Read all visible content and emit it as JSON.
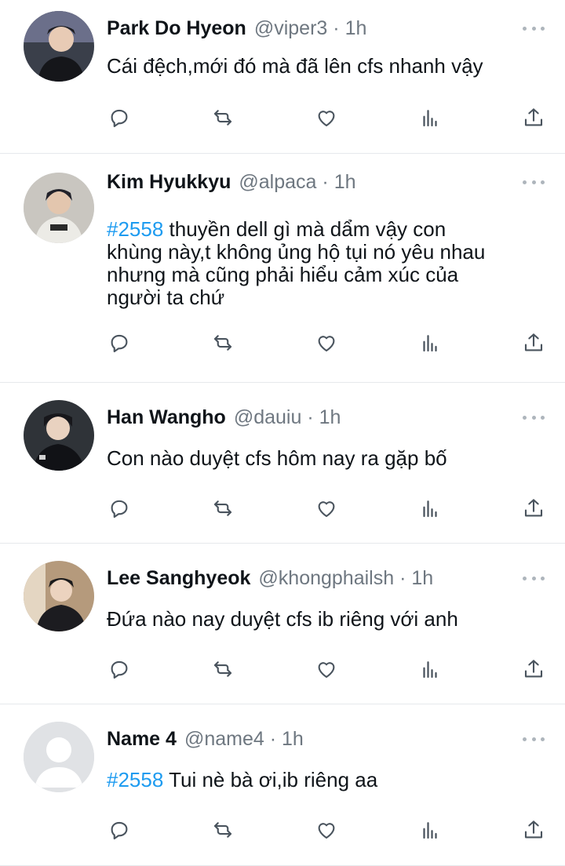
{
  "colors": {
    "hashtag": "#1d9bf0",
    "meta": "#6e7780",
    "icon": "#4a545e",
    "divider": "#e6e9ec"
  },
  "tweets": [
    {
      "name": "Park Do Hyeon",
      "handle": "@viper3",
      "sep": "·",
      "time": "1h",
      "hashtag": "",
      "text": "Cái đệch,mới đó mà đã lên cfs nhanh vậy",
      "avatar": "photo-avatar"
    },
    {
      "name": "Kim Hyukkyu",
      "handle": "@alpaca",
      "sep": "·",
      "time": "1h",
      "hashtag": "#2558",
      "text": " thuyền dell gì mà dẩm vậy con\nkhùng này,t không ủng hộ tụi nó yêu nhau\nnhưng mà cũng phải hiểu cảm xúc của\nngười ta chứ",
      "avatar": "photo-avatar"
    },
    {
      "name": "Han Wangho",
      "handle": "@dauiu",
      "sep": "·",
      "time": "1h",
      "hashtag": "",
      "text": "Con nào duyệt cfs hôm nay ra gặp bố",
      "avatar": "photo-avatar"
    },
    {
      "name": "Lee Sanghyeok",
      "handle": "@khongphailsh",
      "sep": "·",
      "time": "1h",
      "hashtag": "",
      "text": "Đứa nào nay duyệt cfs ib riêng với anh",
      "avatar": "photo-avatar"
    },
    {
      "name": "Name 4",
      "handle": "@name4",
      "sep": "·",
      "time": "1h",
      "hashtag": "#2558",
      "text": " Tui nè bà ơi,ib riêng aa",
      "avatar": "default-avatar"
    }
  ],
  "actions": [
    "reply-icon",
    "retweet-icon",
    "like-icon",
    "views-icon",
    "share-icon"
  ]
}
